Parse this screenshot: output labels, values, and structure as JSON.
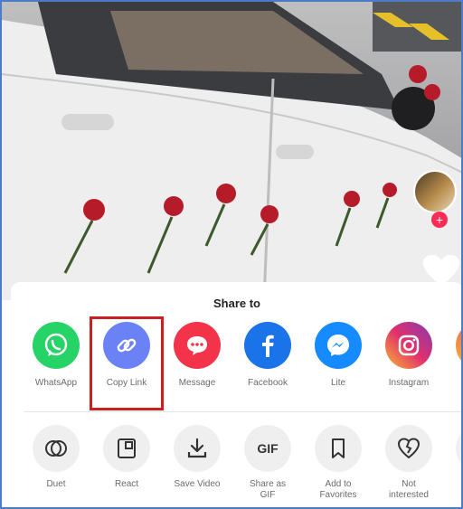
{
  "sheet": {
    "title": "Share to"
  },
  "share_row": [
    {
      "label": "WhatsApp",
      "icon": "whatsapp-icon",
      "color": "#25d366"
    },
    {
      "label": "Copy Link",
      "icon": "link-icon",
      "color": "#6a82f5"
    },
    {
      "label": "Message",
      "icon": "message-icon",
      "color": "#f2334a"
    },
    {
      "label": "Facebook",
      "icon": "facebook-icon",
      "color": "#1a73e8"
    },
    {
      "label": "Lite",
      "icon": "messenger-icon",
      "color": "#168aff"
    },
    {
      "label": "Instagram",
      "icon": "instagram-icon",
      "color": "#c13584"
    }
  ],
  "action_row": [
    {
      "label": "Duet",
      "icon": "duet-icon"
    },
    {
      "label": "React",
      "icon": "react-icon"
    },
    {
      "label": "Save Video",
      "icon": "download-icon"
    },
    {
      "label": "Share as GIF",
      "icon": "gif-icon",
      "glyph": "GIF"
    },
    {
      "label": "Add to Favorites",
      "icon": "bookmark-icon"
    },
    {
      "label": "Not interested",
      "icon": "broken-heart-icon"
    }
  ],
  "highlight_color": "#cc1f1f"
}
